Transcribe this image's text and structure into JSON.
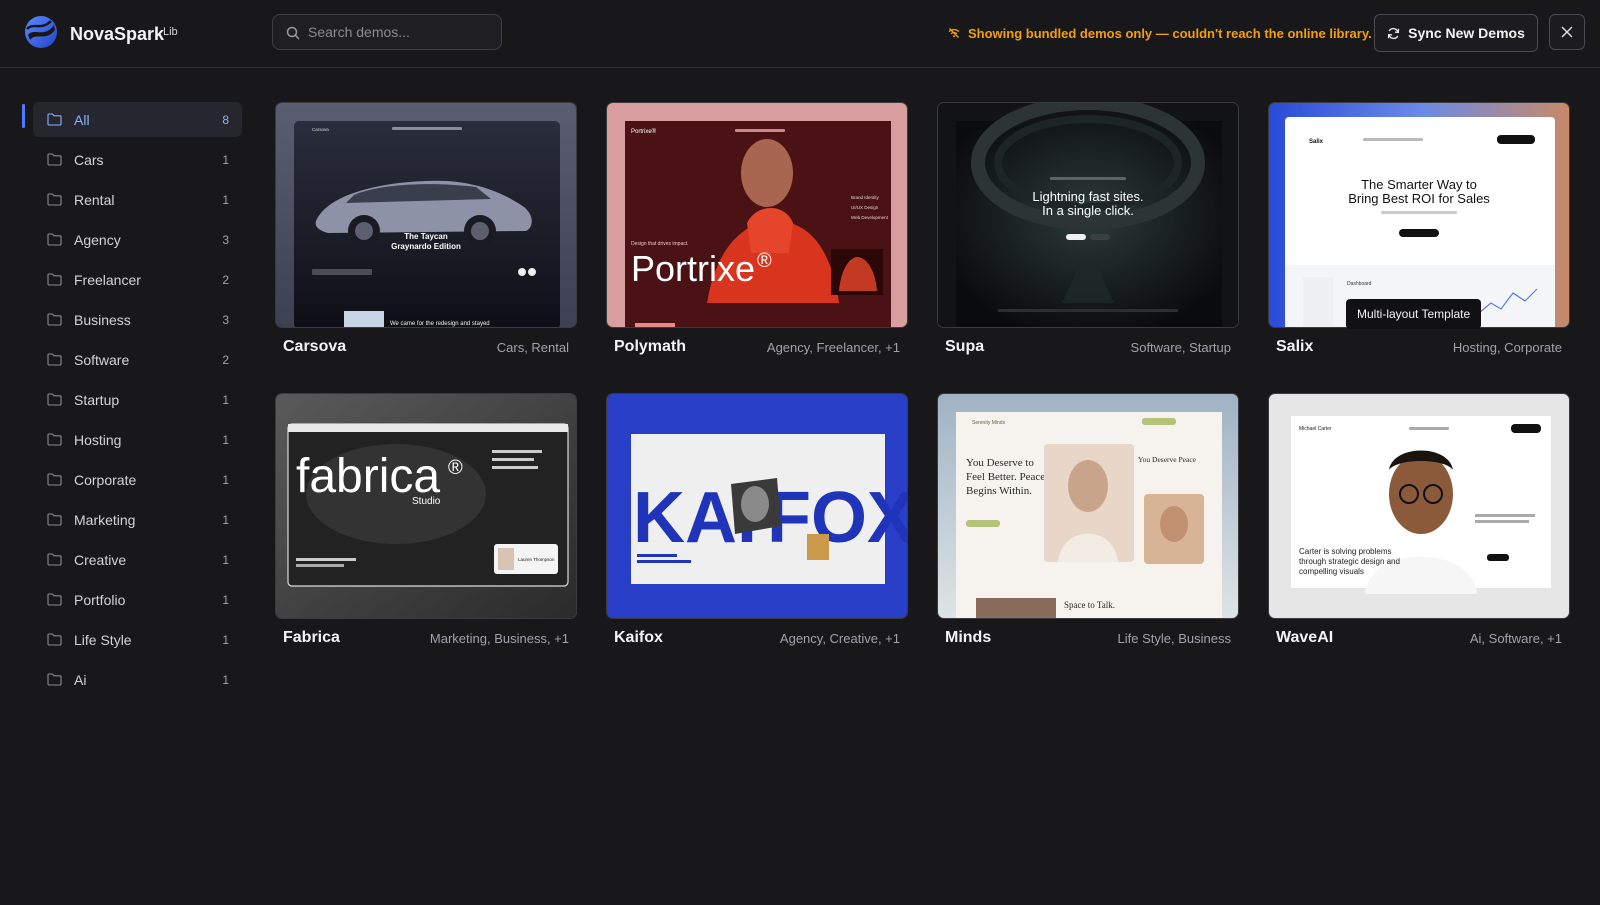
{
  "app": {
    "brand": "NovaSpark",
    "badge": "Lib"
  },
  "search": {
    "placeholder": "Search demos...",
    "value": ""
  },
  "warning": {
    "text": "Showing bundled demos only — couldn't reach the online library.",
    "color": "#f59e0b"
  },
  "actions": {
    "sync_label": "Sync New Demos"
  },
  "sidebar": {
    "categories": [
      {
        "label": "All",
        "count": "8",
        "active": true
      },
      {
        "label": "Cars",
        "count": "1"
      },
      {
        "label": "Rental",
        "count": "1"
      },
      {
        "label": "Agency",
        "count": "3"
      },
      {
        "label": "Freelancer",
        "count": "2"
      },
      {
        "label": "Business",
        "count": "3"
      },
      {
        "label": "Software",
        "count": "2"
      },
      {
        "label": "Startup",
        "count": "1"
      },
      {
        "label": "Hosting",
        "count": "1"
      },
      {
        "label": "Corporate",
        "count": "1"
      },
      {
        "label": "Marketing",
        "count": "1"
      },
      {
        "label": "Creative",
        "count": "1"
      },
      {
        "label": "Portfolio",
        "count": "1"
      },
      {
        "label": "Life Style",
        "count": "1"
      },
      {
        "label": "Ai",
        "count": "1"
      }
    ]
  },
  "demos": [
    {
      "name": "Carsova",
      "tags": "Cars, Rental",
      "preview": {
        "brand": "Carsova",
        "headline_1": "The Taycan",
        "headline_2": "Graynardo Edition",
        "footer": "We came for the redesign and stayed"
      }
    },
    {
      "name": "Polymath",
      "tags": "Agency, Freelancer, +1",
      "preview": {
        "brand": "Portrixe®",
        "headline": "Portrixe",
        "reg": "®",
        "tagline": "Design that drives impact.",
        "services": [
          "Brand Identity",
          "UI/UX Design",
          "Web Development"
        ]
      }
    },
    {
      "name": "Supa",
      "tags": "Software, Startup",
      "preview": {
        "headline_1": "Lightning fast sites.",
        "headline_2": "In a single click."
      }
    },
    {
      "name": "Salix",
      "tags": "Hosting, Corporate",
      "preview": {
        "brand": "Salix",
        "headline_1": "The Smarter Way to",
        "headline_2": "Bring Best ROI for Sales",
        "dash_label": "Dashboard"
      },
      "tooltip": "Multi-layout Template"
    },
    {
      "name": "Fabrica",
      "tags": "Marketing, Business, +1",
      "preview": {
        "headline": "fabrica",
        "reg": "®",
        "sub": "Studio",
        "person": "Lauren Thompson"
      }
    },
    {
      "name": "Kaifox",
      "tags": "Agency, Creative, +1",
      "preview": {
        "left": "KAI",
        "right": "FOX"
      }
    },
    {
      "name": "Minds",
      "tags": "Life Style, Business",
      "preview": {
        "brand": "Serenity Minds",
        "headline_1": "You Deserve to",
        "headline_2": "Feel Better. Peace",
        "headline_3": "Begins Within.",
        "side_1": "You Deserve Peace",
        "footer": "Space to Talk."
      }
    },
    {
      "name": "WaveAI",
      "tags": "Ai, Software, +1",
      "preview": {
        "brand": "Michael Carter",
        "copy_1": "Carter is solving problems",
        "copy_2": "through strategic design and",
        "copy_3": "compelling visuals"
      }
    }
  ]
}
